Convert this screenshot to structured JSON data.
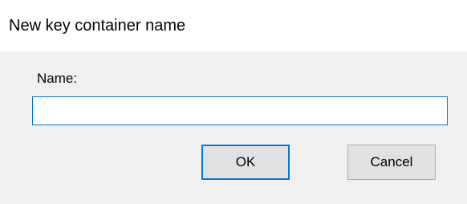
{
  "window": {
    "title": "New key container name"
  },
  "form": {
    "name_label": "Name:",
    "name_value": "",
    "name_placeholder": ""
  },
  "buttons": {
    "ok_label": "OK",
    "cancel_label": "Cancel"
  },
  "colors": {
    "focus_accent": "#0078d7",
    "client_background": "#f0f0f0",
    "button_background": "#e1e1e1",
    "button_border": "#adadad",
    "window_border": "#1e5aa0"
  }
}
